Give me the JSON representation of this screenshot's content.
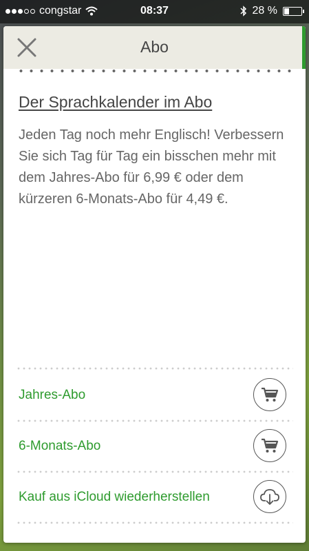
{
  "status_bar": {
    "carrier": "congstar",
    "time": "08:37",
    "battery_percent": "28 %",
    "battery_level": 0.28,
    "signal_bars_filled": 3,
    "signal_bars_total": 5
  },
  "header": {
    "title": "Abo",
    "close_icon": "close-icon",
    "accent_color": "#2e9b2e"
  },
  "content": {
    "title": "Der Sprachkalender im Abo",
    "body": "Jeden Tag noch mehr Englisch! Verbessern Sie sich Tag für Tag ein bisschen mehr mit dem Jahres-Abo für 6,99 € oder dem kürzeren 6-Monats-Abo für 4,49 €."
  },
  "options": [
    {
      "label": "Jahres-Abo",
      "icon": "shopping-cart-icon"
    },
    {
      "label": "6-Monats-Abo",
      "icon": "shopping-cart-icon"
    },
    {
      "label": "Kauf aus iCloud wiederherstellen",
      "icon": "cloud-download-icon"
    }
  ],
  "colors": {
    "link_green": "#2e9b2e",
    "header_bg": "#ecebe3"
  }
}
